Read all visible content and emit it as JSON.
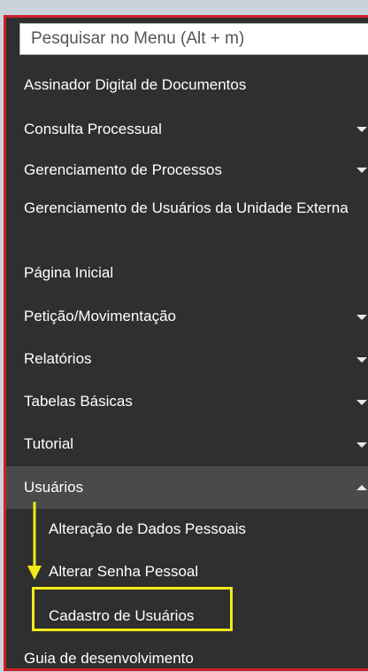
{
  "search": {
    "placeholder": "Pesquisar no Menu (Alt + m)"
  },
  "menu": {
    "items": [
      {
        "label": "Assinador Digital de Documentos"
      },
      {
        "label": "Consulta Processual"
      },
      {
        "label": "Gerenciamento de Processos"
      },
      {
        "label": "Gerenciamento de Usuários da Unidade Externa"
      },
      {
        "label": "Página Inicial"
      },
      {
        "label": "Petição/Movimentação"
      },
      {
        "label": "Relatórios"
      },
      {
        "label": "Tabelas Básicas"
      },
      {
        "label": "Tutorial"
      },
      {
        "label": "Usuários"
      },
      {
        "label": "Alteração de Dados Pessoais"
      },
      {
        "label": "Alterar Senha Pessoal"
      },
      {
        "label": "Cadastro de Usuários"
      },
      {
        "label": "Guia de desenvolvimento"
      }
    ]
  },
  "colors": {
    "menu_bg": "#2f2f2f",
    "frame_border": "#cf1f2a",
    "annotation": "#f2ea16",
    "active_bg": "#4a4a4a"
  }
}
